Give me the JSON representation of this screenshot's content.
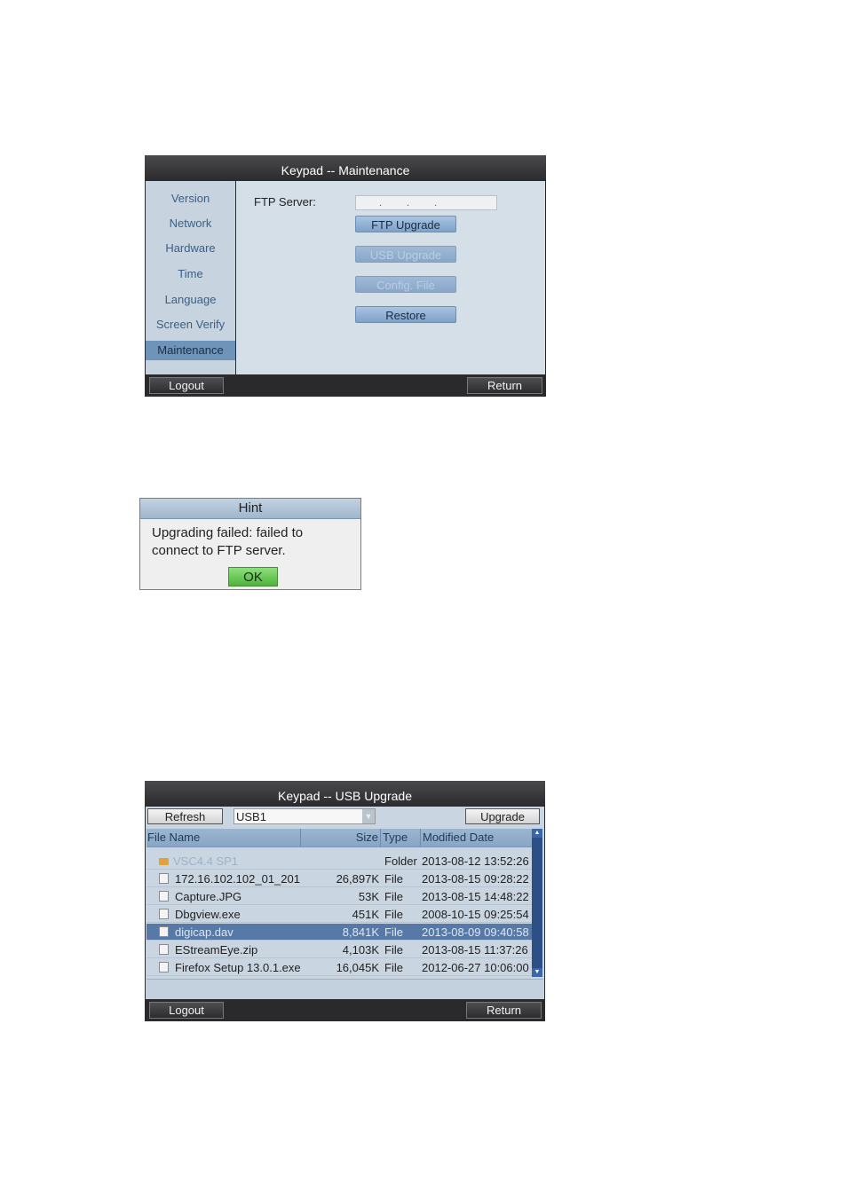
{
  "maintenance": {
    "title": "Keypad -- Maintenance",
    "sidebar": [
      "Version",
      "Network",
      "Hardware",
      "Time",
      "Language",
      "Screen Verify",
      "Maintenance"
    ],
    "active_item": "Maintenance",
    "ftp_label": "FTP Server:",
    "ftp_value": "...",
    "buttons": {
      "ftp_upgrade": "FTP Upgrade",
      "usb_upgrade": "USB Upgrade",
      "config_file": "Config. File",
      "restore": "Restore"
    },
    "logout": "Logout",
    "return": "Return"
  },
  "hint": {
    "title": "Hint",
    "message": "Upgrading failed:  failed to connect to FTP server.",
    "ok": "OK"
  },
  "usb_upgrade": {
    "title": "Keypad -- USB Upgrade",
    "refresh": "Refresh",
    "device": "USB1",
    "upgrade": "Upgrade",
    "columns": {
      "file_name": "File Name",
      "size": "Size",
      "type": "Type",
      "modified": "Modified Date"
    },
    "rows": [
      {
        "name": "VSC4.4 SP1",
        "size": "",
        "type": "Folder",
        "date": "2013-08-12 13:52:26",
        "icon": "folder-icon"
      },
      {
        "name": "172.16.102.102_01_201",
        "size": "26,897K",
        "type": "File",
        "date": "2013-08-15 09:28:22",
        "icon": "file-icon"
      },
      {
        "name": "Capture.JPG",
        "size": "53K",
        "type": "File",
        "date": "2013-08-15 14:48:22",
        "icon": "file-icon"
      },
      {
        "name": "Dbgview.exe",
        "size": "451K",
        "type": "File",
        "date": "2008-10-15 09:25:54",
        "icon": "file-icon"
      },
      {
        "name": "digicap.dav",
        "size": "8,841K",
        "type": "File",
        "date": "2013-08-09 09:40:58",
        "icon": "file-icon"
      },
      {
        "name": "EStreamEye.zip",
        "size": "4,103K",
        "type": "File",
        "date": "2013-08-15 11:37:26",
        "icon": "file-icon"
      },
      {
        "name": "Firefox Setup 13.0.1.exe",
        "size": "16,045K",
        "type": "File",
        "date": "2012-06-27 10:06:00",
        "icon": "file-icon"
      }
    ],
    "selected_row": "digicap.dav",
    "logout": "Logout",
    "return": "Return"
  }
}
